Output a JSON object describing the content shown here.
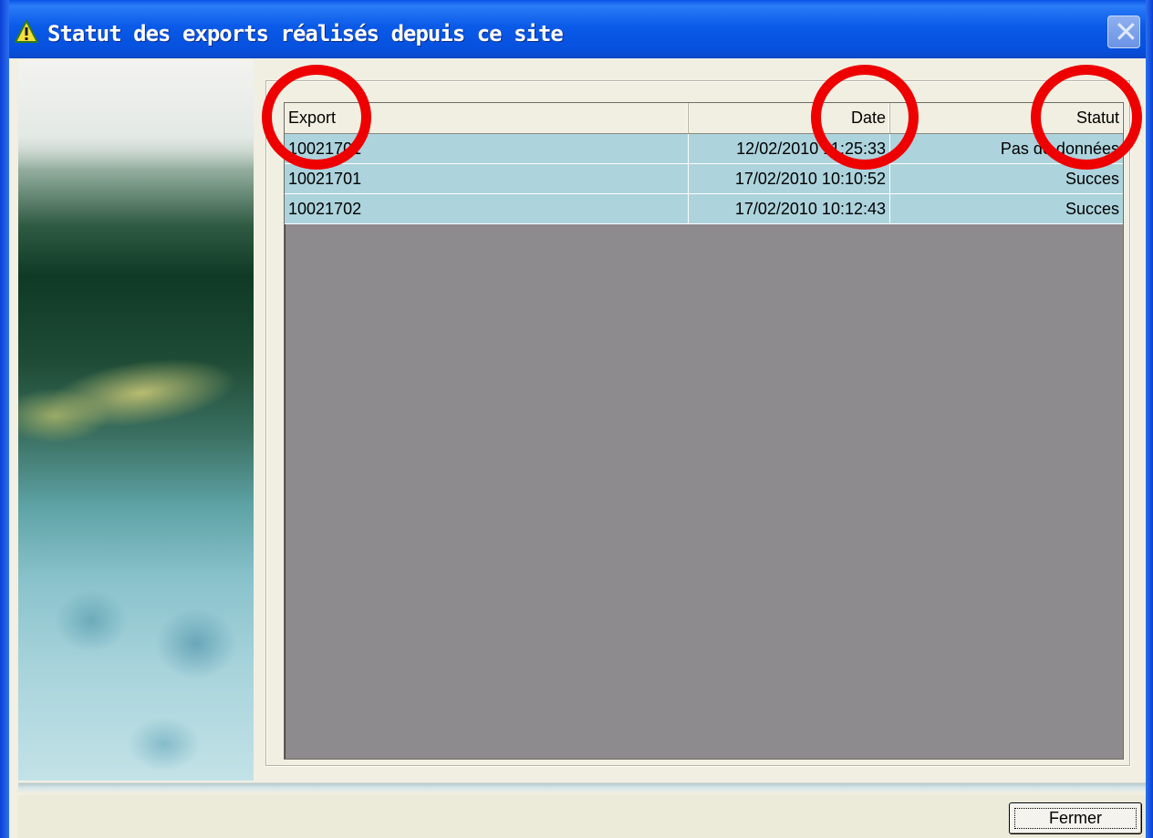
{
  "window": {
    "title": "Statut des exports réalisés depuis ce site",
    "title_icon": "warning-triangle-icon",
    "close_icon": "close-icon",
    "title_color": "#0a5ae8"
  },
  "table": {
    "columns": [
      "Export",
      "Date",
      "Statut"
    ],
    "rows": [
      {
        "export": "10021701",
        "date": "12/02/2010 11:25:33",
        "statut": "Pas de données"
      },
      {
        "export": "10021701",
        "date": "17/02/2010 10:10:52",
        "statut": "Succes"
      },
      {
        "export": "10021702",
        "date": "17/02/2010 10:12:43",
        "statut": "Succes"
      }
    ],
    "row_color": "#add3dd",
    "empty_area_color": "#8e8b8e"
  },
  "footer": {
    "close_label": "Fermer"
  },
  "annotations": {
    "color": "#ee0000"
  }
}
